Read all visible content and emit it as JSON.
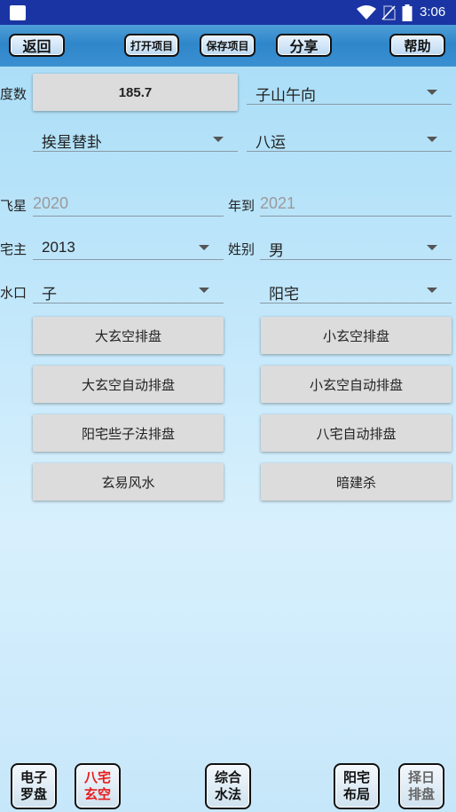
{
  "status_bar": {
    "time": "3:06",
    "icons": [
      "app-icon",
      "wifi-icon",
      "sim-icon",
      "battery-icon"
    ]
  },
  "toolbar": {
    "back": "返回",
    "open_project": "打开项目",
    "save_project": "保存项目",
    "share": "分享",
    "help": "帮助"
  },
  "form": {
    "degree_label": "度数",
    "degree_value": "185.7",
    "mountain_value": "子山午向",
    "method_value": "挨星替卦",
    "period_value": "八运",
    "flying_star_label": "飞星",
    "year_from": "2020",
    "year_to_label": "年到",
    "year_to": "2021",
    "owner_label": "宅主",
    "owner_year": "2013",
    "gender_label": "姓别",
    "gender_value": "男",
    "water_label": "水口",
    "water_value": "子",
    "house_type_value": "阳宅"
  },
  "actions": {
    "big_xuankong": "大玄空排盘",
    "small_xuankong": "小玄空排盘",
    "big_xuankong_auto": "大玄空自动排盘",
    "small_xuankong_auto": "小玄空自动排盘",
    "yangzhai_xiezi": "阳宅些子法排盘",
    "bazhai_auto": "八宅自动排盘",
    "xuanyi_fengshui": "玄易风水",
    "anjiansha": "暗建杀"
  },
  "bottom_nav": [
    {
      "line1": "电子",
      "line2": "罗盘"
    },
    {
      "line1": "八宅",
      "line2": "玄空"
    },
    {
      "line1": "综合",
      "line2": "水法"
    },
    {
      "line1": "阳宅",
      "line2": "布局"
    },
    {
      "line1": "择日",
      "line2": "排盘"
    }
  ],
  "colors": {
    "status_bar": "#1a35a3",
    "title_bar": "#2f86c9",
    "active_nav_text": "#e81c1c"
  }
}
